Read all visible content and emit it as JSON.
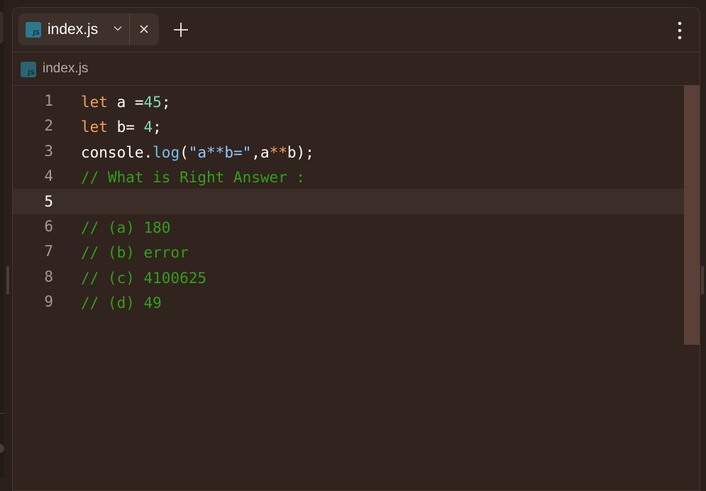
{
  "tab": {
    "icon": "js-file-icon",
    "icon_text": "JS",
    "label": "index.js"
  },
  "breadcrumb": {
    "icon_text": "JS",
    "label": "index.js"
  },
  "editor": {
    "active_line": 5,
    "lines": [
      {
        "number": "1",
        "tokens": [
          {
            "t": "let",
            "c": "kw"
          },
          {
            "t": " a =",
            "c": ""
          },
          {
            "t": "45",
            "c": "num"
          },
          {
            "t": ";",
            "c": ""
          }
        ]
      },
      {
        "number": "2",
        "tokens": [
          {
            "t": "let",
            "c": "kw"
          },
          {
            "t": " b= ",
            "c": ""
          },
          {
            "t": "4",
            "c": "num"
          },
          {
            "t": ";",
            "c": ""
          }
        ]
      },
      {
        "number": "3",
        "tokens": [
          {
            "t": "console.",
            "c": ""
          },
          {
            "t": "log",
            "c": "fn"
          },
          {
            "t": "(",
            "c": ""
          },
          {
            "t": "\"a**b=\"",
            "c": "str"
          },
          {
            "t": ",a",
            "c": ""
          },
          {
            "t": "**",
            "c": "op"
          },
          {
            "t": "b);",
            "c": ""
          }
        ]
      },
      {
        "number": "4",
        "tokens": [
          {
            "t": "// What is Right Answer :",
            "c": "cm"
          }
        ]
      },
      {
        "number": "5",
        "tokens": []
      },
      {
        "number": "6",
        "tokens": [
          {
            "t": "// (a) 180",
            "c": "cm"
          }
        ]
      },
      {
        "number": "7",
        "tokens": [
          {
            "t": "// (b) error",
            "c": "cm"
          }
        ]
      },
      {
        "number": "8",
        "tokens": [
          {
            "t": "// (c) 4100625",
            "c": "cm"
          }
        ]
      },
      {
        "number": "9",
        "tokens": [
          {
            "t": "// (d) 49",
            "c": "cm"
          }
        ]
      }
    ]
  },
  "colors": {
    "keyword": "#f0a05b",
    "number": "#7fd9b5",
    "function": "#76bdf0",
    "string": "#8ec8f5",
    "comment": "#31a01a"
  }
}
